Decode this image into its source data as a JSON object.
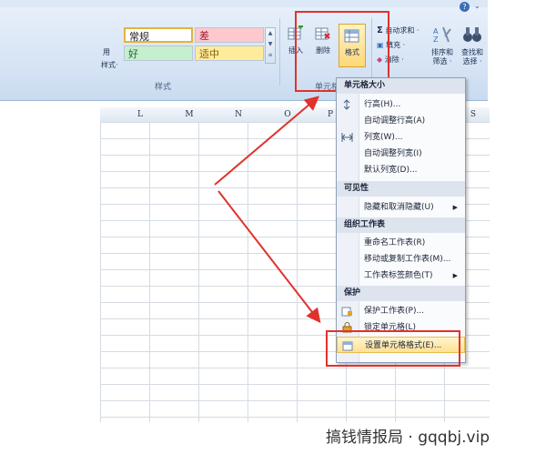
{
  "ribbon": {
    "styles_group": {
      "cells": [
        "常规",
        "差",
        "好",
        "适中"
      ],
      "left_cut_labels": [
        "用",
        "样式·"
      ],
      "group_label": "样式"
    },
    "cells_group": {
      "insert_label": "插入",
      "delete_label": "删除",
      "format_label": "格式",
      "group_label": "单元格"
    },
    "edit_group": {
      "autosum_label": "自动求和 ·",
      "fill_label": "填充 ·",
      "clear_label": "清除 ·",
      "sort_label": "排序和",
      "sort_label2": "筛选 ·",
      "find_label": "查找和",
      "find_label2": "选择 ·"
    }
  },
  "sheet": {
    "columns": [
      "L",
      "M",
      "N",
      "O",
      "P",
      "S"
    ]
  },
  "menu": {
    "sections": [
      {
        "header": "单元格大小",
        "items": [
          {
            "label": "行高(H)...",
            "icon": "row-height-icon"
          },
          {
            "label": "自动调整行高(A)"
          },
          {
            "label": "列宽(W)...",
            "icon": "column-width-icon"
          },
          {
            "label": "自动调整列宽(I)"
          },
          {
            "label": "默认列宽(D)..."
          }
        ]
      },
      {
        "header": "可见性",
        "items": [
          {
            "label": "隐藏和取消隐藏(U)",
            "submenu": true
          }
        ]
      },
      {
        "header": "组织工作表",
        "items": [
          {
            "label": "重命名工作表(R)"
          },
          {
            "label": "移动或复制工作表(M)..."
          },
          {
            "label": "工作表标签颜色(T)",
            "submenu": true
          }
        ]
      },
      {
        "header": "保护",
        "items": [
          {
            "label": "保护工作表(P)...",
            "icon": "protect-sheet-icon"
          },
          {
            "label": "锁定单元格(L)",
            "icon": "lock-cell-icon"
          },
          {
            "label": "设置单元格格式(E)...",
            "icon": "format-cells-icon"
          }
        ]
      }
    ]
  },
  "watermark": "搞钱情报局 · gqqbj.vip",
  "colors": {
    "annotation": "#e0322c",
    "bad_fill": "#ffc7ce",
    "good_fill": "#c6efce",
    "neutral_fill": "#ffeb9c"
  }
}
